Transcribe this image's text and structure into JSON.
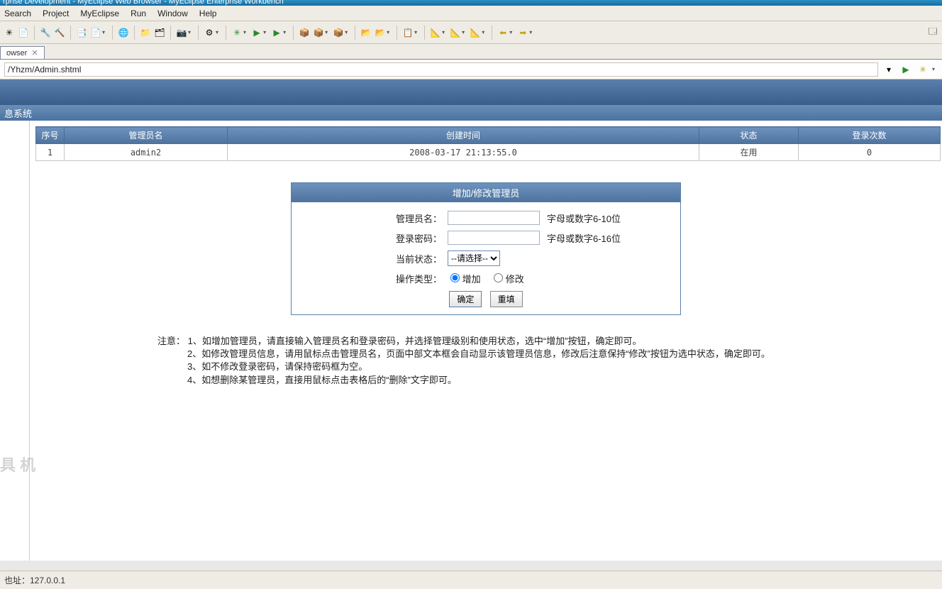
{
  "window_title": "rprise Development - MyEclipse Web Browser - MyEclipse Enterprise Workbench",
  "menu": [
    "Search",
    "Project",
    "MyEclipse",
    "Run",
    "Window",
    "Help"
  ],
  "tab_label": "owser",
  "address": "/Yhzm/Admin.shtml",
  "app_subhead": "息系统",
  "table": {
    "headers": [
      "序号",
      "管理员名",
      "创建时间",
      "状态",
      "登录次数"
    ],
    "rows": [
      {
        "seq": "1",
        "name": "admin2",
        "created": "2008-03-17 21:13:55.0",
        "status": "在用",
        "logins": "0"
      }
    ]
  },
  "form": {
    "title": "增加/修改管理员",
    "admin_label": "管理员名：",
    "admin_hint": "字母或数字6-10位",
    "pwd_label": "登录密码：",
    "pwd_hint": "字母或数字6-16位",
    "status_label": "当前状态：",
    "status_placeholder": "--请选择--",
    "op_label": "操作类型：",
    "op_add": "增加",
    "op_mod": "修改",
    "confirm": "确定",
    "reset": "重填"
  },
  "notes_title": "注意：",
  "notes": [
    "1、如增加管理员，请直接输入管理员名和登录密码，并选择管理级别和使用状态，选中“增加”按钮，确定即可。",
    "2、如修改管理员信息，请用鼠标点击管理员名，页面中部文本框会自动显示该管理员信息，修改后注意保持“修改”按钮为选中状态，确定即可。",
    "3、如不修改登录密码，请保持密码框为空。",
    "4、如想删除某管理员，直接用鼠标点击表格后的“删除”文字即可。"
  ],
  "status_bar": "也址：127.0.0.1",
  "watermark": "具\n机"
}
